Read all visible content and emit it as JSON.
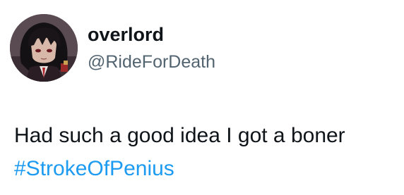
{
  "author": {
    "display_name": "overlord",
    "handle": "@RideForDeath",
    "avatar_icon": "anime-character-avatar"
  },
  "tweet": {
    "text": "Had such a good idea I got a boner",
    "hashtag": "#StrokeOfPenius"
  },
  "colors": {
    "text_primary": "#0f1419",
    "text_secondary": "#536471",
    "link": "#1d9bf0",
    "background": "#ffffff"
  }
}
